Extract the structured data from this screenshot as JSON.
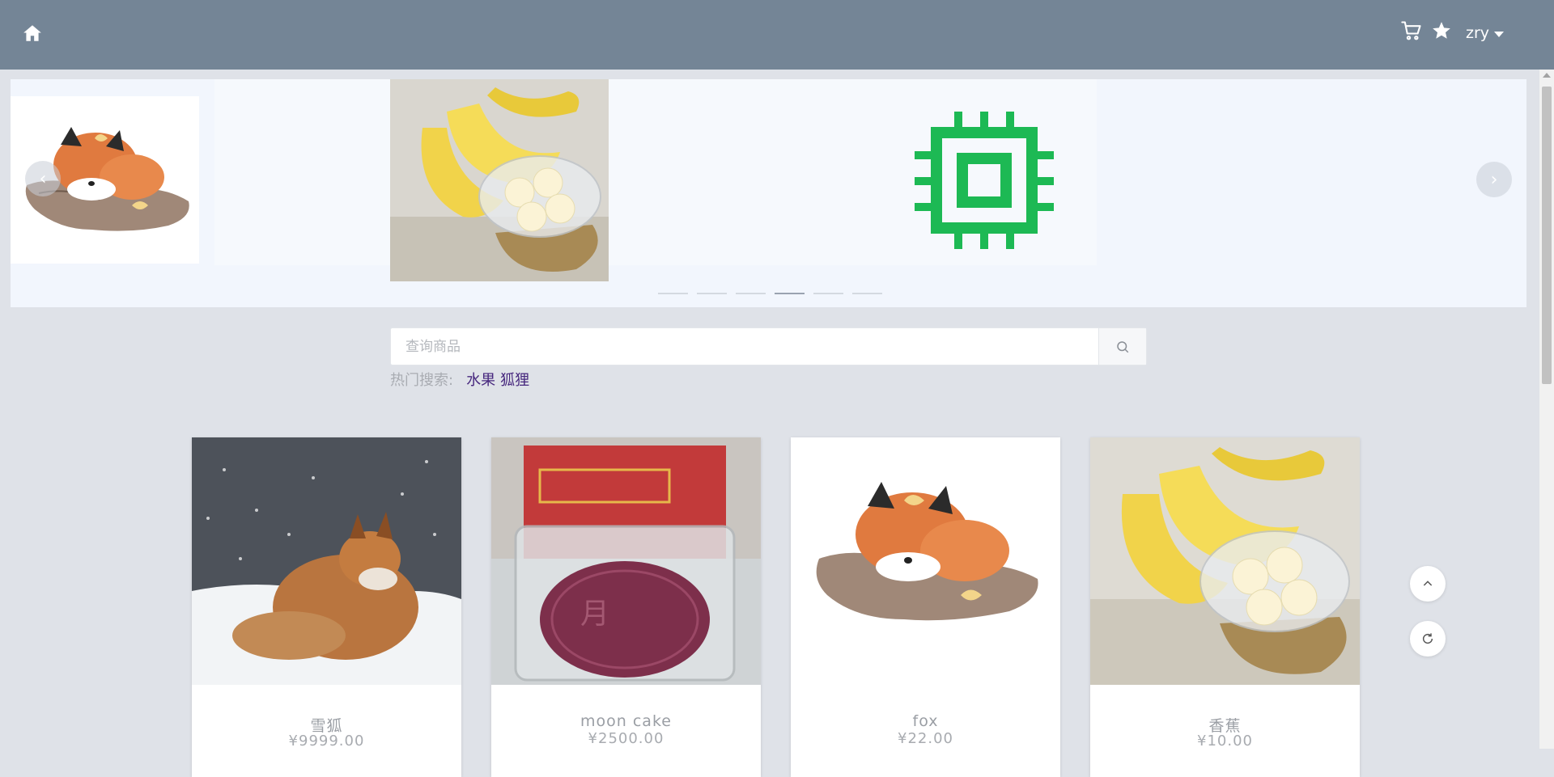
{
  "header": {
    "icons": {
      "home": "home-icon",
      "cart": "cart-icon",
      "favorites": "star-icon"
    },
    "username": "zry"
  },
  "carousel": {
    "slides": [
      "fox-illustration",
      "bananas",
      "chip-icon"
    ],
    "indicator_count": 6,
    "active_index": 3,
    "chip_color": "#1db954"
  },
  "search": {
    "placeholder": "查询商品",
    "hot_label": "热门搜索:",
    "hot_terms": [
      "水果",
      "狐狸"
    ]
  },
  "products": [
    {
      "name": "雪狐",
      "price": "¥9999.00"
    },
    {
      "name": "moon cake",
      "price": "¥2500.00"
    },
    {
      "name": "fox",
      "price": "¥22.00"
    },
    {
      "name": "香蕉",
      "price": "¥10.00"
    }
  ],
  "colors": {
    "topbar": "#748596",
    "background": "#dfe2e8",
    "hot_link": "#47287e"
  }
}
